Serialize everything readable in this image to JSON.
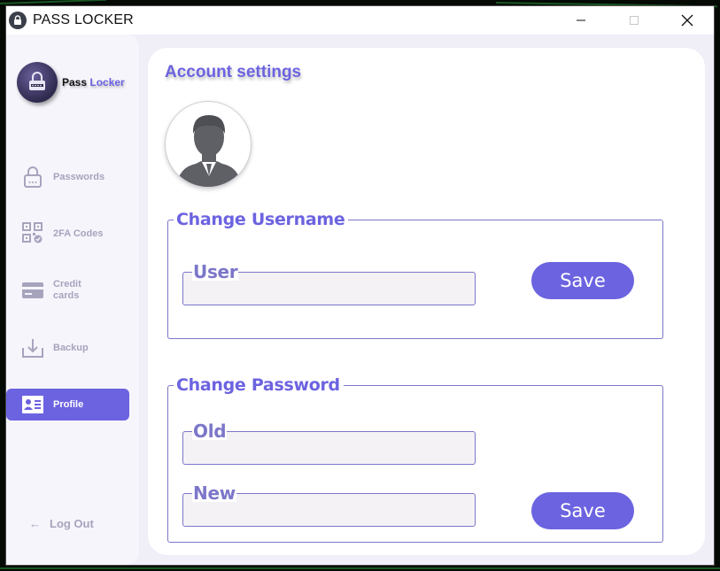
{
  "window": {
    "title": "PASS LOCKER",
    "controls": [
      "minimize-icon",
      "maximize-icon",
      "close-icon"
    ]
  },
  "brand": {
    "pass": "Pass",
    "locker": "Locker"
  },
  "colors": {
    "accent": "#6c63e0",
    "muted": "#a6a4bd",
    "field_bg": "#f4f2f5",
    "sidebar_bg": "#f6f5fb"
  },
  "sidebar": {
    "items": [
      {
        "label": "Passwords",
        "icon": "lock-icon",
        "active": false
      },
      {
        "label": "2FA Codes",
        "icon": "qr-code-icon",
        "active": false
      },
      {
        "label": "Credit cards",
        "icon": "credit-card-icon",
        "active": false
      },
      {
        "label": "Backup",
        "icon": "download-icon",
        "active": false
      },
      {
        "label": "Profile",
        "icon": "profile-card-icon",
        "active": true
      }
    ],
    "logout": {
      "label": "Log Out",
      "icon": "arrow-left-icon"
    }
  },
  "main": {
    "title": "Account settings",
    "avatar_icon": "user-avatar-icon",
    "username_section": {
      "title": "Change Username",
      "user_label": "User",
      "user_value": "",
      "save_label": "Save"
    },
    "password_section": {
      "title": "Change Password",
      "old_label": "Old",
      "old_value": "",
      "new_label": "New",
      "new_value": "",
      "save_label": "Save"
    }
  }
}
